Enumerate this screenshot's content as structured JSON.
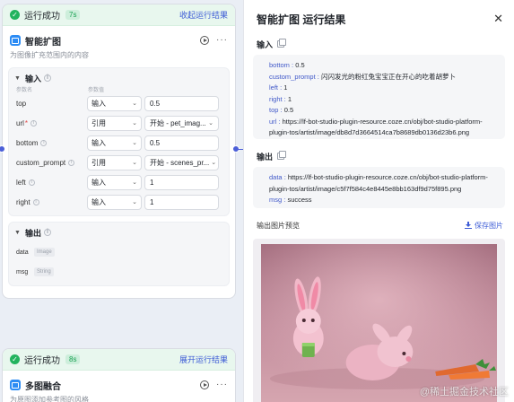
{
  "node1": {
    "status": "运行成功",
    "duration": "7s",
    "collapse_link": "收起运行结果",
    "title": "智能扩图",
    "description": "为图像扩充范围内的内容",
    "input_section": {
      "title": "输入",
      "col_name": "参数名",
      "col_value": "参数值",
      "params": [
        {
          "name": "top",
          "required": false,
          "info": false,
          "mode": "输入",
          "value": "0.5",
          "dropdown": false
        },
        {
          "name": "url",
          "required": true,
          "info": true,
          "mode": "引用",
          "value": "开始 - pet_imag...",
          "dropdown": true
        },
        {
          "name": "bottom",
          "required": false,
          "info": true,
          "mode": "输入",
          "value": "0.5",
          "dropdown": false
        },
        {
          "name": "custom_prompt",
          "required": false,
          "info": true,
          "mode": "引用",
          "value": "开始 - scenes_pr...",
          "dropdown": true
        },
        {
          "name": "left",
          "required": false,
          "info": true,
          "mode": "输入",
          "value": "1",
          "dropdown": false
        },
        {
          "name": "right",
          "required": false,
          "info": true,
          "mode": "输入",
          "value": "1",
          "dropdown": false
        }
      ]
    },
    "output_section": {
      "title": "输出",
      "outputs": [
        {
          "name": "data",
          "type": "Image"
        },
        {
          "name": "msg",
          "type": "String"
        }
      ]
    }
  },
  "node2": {
    "status": "运行成功",
    "duration": "8s",
    "expand_link": "展开运行结果",
    "title": "多图融合",
    "description": "为原图添加参考图的风格"
  },
  "result_panel": {
    "title": "智能扩图 运行结果",
    "input_label": "输入",
    "input_fields": [
      {
        "key": "bottom",
        "value": "0.5"
      },
      {
        "key": "custom_prompt",
        "value": "闪闪发光的粉红兔宝宝正在开心的吃着胡萝卜"
      },
      {
        "key": "left",
        "value": "1"
      },
      {
        "key": "right",
        "value": "1"
      },
      {
        "key": "top",
        "value": "0.5"
      },
      {
        "key": "url",
        "value": "https://lf-bot-studio-plugin-resource.coze.cn/obj/bot-studio-platform-plugin-tos/artist/image/db8d7d3664514ca7b8689db0136d23b6.png"
      }
    ],
    "output_label": "输出",
    "output_fields": [
      {
        "key": "data",
        "value": "https://lf-bot-studio-plugin-resource.coze.cn/obj/bot-studio-platform-plugin-tos/artist/image/c5f7f584c4e8445e8bb163df9d75f895.png"
      },
      {
        "key": "msg",
        "value": "success"
      }
    ],
    "preview_label": "输出图片预览",
    "save_label": "保存图片",
    "watermark": "@稀土掘金技术社区"
  },
  "colors": {
    "accent": "#3c5bd6",
    "success": "#22b35e",
    "port": "#4c5fd8"
  },
  "icons": [
    "check-circle-icon",
    "image-extend-icon",
    "play-icon",
    "more-icon",
    "chevron-down-icon",
    "info-icon",
    "copy-icon",
    "close-icon",
    "download-icon"
  ]
}
